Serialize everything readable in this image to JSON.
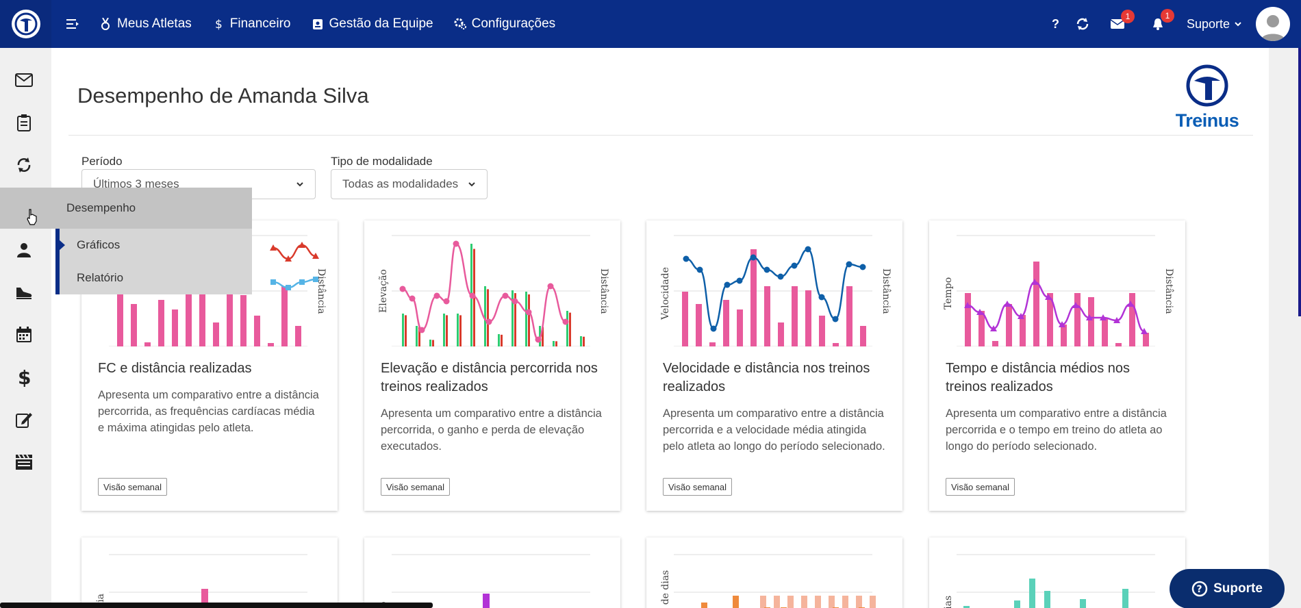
{
  "nav": {
    "items": [
      {
        "label": "Meus Atletas",
        "icon": "medal-icon"
      },
      {
        "label": "Financeiro",
        "icon": "dollar-icon"
      },
      {
        "label": "Gestão da Equipe",
        "icon": "badge-icon"
      },
      {
        "label": "Configurações",
        "icon": "gears-icon"
      }
    ],
    "help_label": "?",
    "mail_badge": "1",
    "bell_badge": "1",
    "user_label": "Suporte"
  },
  "sidebar": {
    "icons": [
      "mail-icon",
      "clipboard-icon",
      "sync-icon",
      "chart-line-icon",
      "user-icon",
      "shoe-icon",
      "calendar-icon",
      "dollar-icon",
      "edit-icon",
      "film-icon"
    ]
  },
  "flyout": {
    "title": "Desempenho",
    "items": [
      {
        "label": "Gráficos",
        "active": true
      },
      {
        "label": "Relatório",
        "active": false
      }
    ]
  },
  "page": {
    "title": "Desempenho de Amanda Silva",
    "logo_text": "Treinus"
  },
  "filters": {
    "period_label": "Período",
    "period_value": "Últimos 3 meses",
    "modality_label": "Tipo de modalidade",
    "modality_value": "Todas as modalidades"
  },
  "cards": [
    {
      "title": "FC e distância realizadas",
      "description": "Apresenta um comparativo entre a distância percorrida, as frequências cardíacas média e máxima atingidas pelo atleta.",
      "button": "Visão semanal",
      "axis_right": "Distância"
    },
    {
      "title": "Elevação e distância percorrida nos treinos realizados",
      "description": "Apresenta um comparativo entre a distância percorrida, o ganho e perda de elevação executados.",
      "button": "Visão semanal",
      "axis_left": "Elevação",
      "axis_right": "Distância"
    },
    {
      "title": "Velocidade e distância nos treinos realizados",
      "description": "Apresenta um comparativo entre a distância percorrida e a velocidade média atingida pelo atleta ao longo do período selecionado.",
      "button": "Visão semanal",
      "axis_left": "Velocidade",
      "axis_right": "Distância"
    },
    {
      "title": "Tempo e distância médios nos treinos realizados",
      "description": "Apresenta um comparativo entre a distância percorrida e o tempo em treino do atleta ao longo do período selecionado.",
      "button": "Visão semanal",
      "axis_left": "Tempo",
      "axis_right": "Distância"
    }
  ],
  "lower_cards": [
    {
      "axis_left": "ância"
    },
    {
      "axis_left": "npo"
    },
    {
      "axis_left": "de de dias"
    },
    {
      "axis_left": "orias"
    }
  ],
  "support_button": "Suporte",
  "colors": {
    "nav_bg": "#0a2d87",
    "pink": "#e85a9c",
    "red": "#d93a2b",
    "light_blue": "#55b4e6",
    "dark_blue": "#0e5fa8",
    "purple": "#b233d6",
    "green": "#2ecc71",
    "orange": "#ef8a3c",
    "teal": "#5ad1b9"
  }
}
